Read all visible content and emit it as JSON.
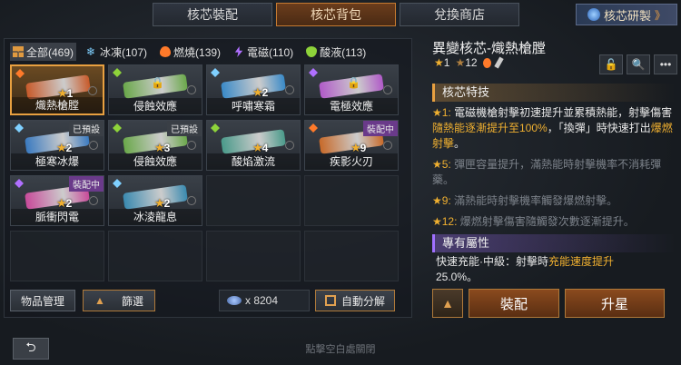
{
  "tabs": [
    {
      "label": "核芯裝配",
      "active": false
    },
    {
      "label": "核芯背包",
      "active": true
    },
    {
      "label": "兌換商店",
      "active": false
    }
  ],
  "research_label": "核芯研製",
  "research_arrow": "》",
  "filters": [
    {
      "label": "全部(469)",
      "icon": "grid-icon",
      "active": true
    },
    {
      "label": "冰凍(107)",
      "icon": "snowflake-icon",
      "active": false
    },
    {
      "label": "燃燒(139)",
      "icon": "flame-icon",
      "active": false
    },
    {
      "label": "電磁(110)",
      "icon": "lightning-icon",
      "active": false
    },
    {
      "label": "酸液(113)",
      "icon": "acid-drop-icon",
      "active": false
    }
  ],
  "cards": [
    {
      "name": "熾熱槍膛",
      "level": "1",
      "tag": "",
      "selected": true,
      "locked": false,
      "gun_color": "#c85a2a",
      "elem_color": "#ff7a2a"
    },
    {
      "name": "侵蝕效應",
      "level": "",
      "tag": "",
      "selected": false,
      "locked": true,
      "gun_color": "#6aa84a",
      "elem_color": "#8ed33a"
    },
    {
      "name": "呼嘯寒霜",
      "level": "2",
      "tag": "",
      "selected": false,
      "locked": false,
      "gun_color": "#3a8ac8",
      "elem_color": "#7fd0ff"
    },
    {
      "name": "電極效應",
      "level": "",
      "tag": "",
      "selected": false,
      "locked": true,
      "gun_color": "#b05ac8",
      "elem_color": "#b070ff"
    },
    {
      "name": "極寒冰爆",
      "level": "2",
      "tag": "已預設",
      "selected": false,
      "locked": false,
      "gun_color": "#3a7ac0",
      "elem_color": "#7fd0ff"
    },
    {
      "name": "侵蝕效應",
      "level": "3",
      "tag": "已預設",
      "selected": false,
      "locked": false,
      "gun_color": "#6aa84a",
      "elem_color": "#8ed33a"
    },
    {
      "name": "酸焰激流",
      "level": "4",
      "tag": "",
      "selected": false,
      "locked": false,
      "gun_color": "#4a9a8a",
      "elem_color": "#8ed33a"
    },
    {
      "name": "疾影火刃",
      "level": "9",
      "tag": "裝配中",
      "selected": false,
      "locked": false,
      "gun_color": "#c86a2a",
      "elem_color": "#ff7a2a"
    },
    {
      "name": "脈衝閃電",
      "level": "2",
      "tag": "裝配中",
      "selected": false,
      "locked": false,
      "gun_color": "#c84a9a",
      "elem_color": "#b070ff"
    },
    {
      "name": "冰淩龍息",
      "level": "2",
      "tag": "",
      "selected": false,
      "locked": false,
      "gun_color": "#3a8ab0",
      "elem_color": "#7fd0ff"
    }
  ],
  "bottom": {
    "manage_label": "物品管理",
    "filter_icon": "▲",
    "filter_label": "篩選",
    "currency_icon": "core-fragment-icon",
    "currency_value": "x 8204",
    "decompose_label": "自動分解"
  },
  "detail": {
    "title": "異變核芯-熾熱槍膛",
    "star": "1",
    "star2": "12",
    "section1": "核芯特技",
    "traits": [
      {
        "star": "★1: ",
        "text_a": "電磁機槍射擊初速提升並累積熱能，射擊傷害",
        "hl": "隨熱能逐漸提升至100%",
        "text_b": "，「換彈」時快速打出",
        "hl2": "爆燃射擊",
        "text_c": "。",
        "dim": false
      },
      {
        "star": "★5: ",
        "text_a": "彈匣容量提升，滿熱能時射擊機率不消耗彈藥。",
        "hl": "",
        "text_b": "",
        "hl2": "",
        "text_c": "",
        "dim": true
      },
      {
        "star": "★9: ",
        "text_a": "滿熱能時射擊機率觸發爆燃射擊。",
        "hl": "",
        "text_b": "",
        "hl2": "",
        "text_c": "",
        "dim": true
      },
      {
        "star": "★12: ",
        "text_a": "爆燃射擊傷害隨觸發次數逐漸提升。",
        "hl": "",
        "text_b": "",
        "hl2": "",
        "text_c": "",
        "dim": true
      }
    ],
    "section2": "專有屬性",
    "prop_a": "快速充能·中級：射擊時",
    "prop_hl": "充能速度提升",
    "prop_b": "25.0%。",
    "equip_label": "裝配",
    "upgrade_label": "升星",
    "up_icon": "▲"
  },
  "footer": {
    "back_icon": "⮌",
    "hint": "點擊空白處關閉"
  }
}
